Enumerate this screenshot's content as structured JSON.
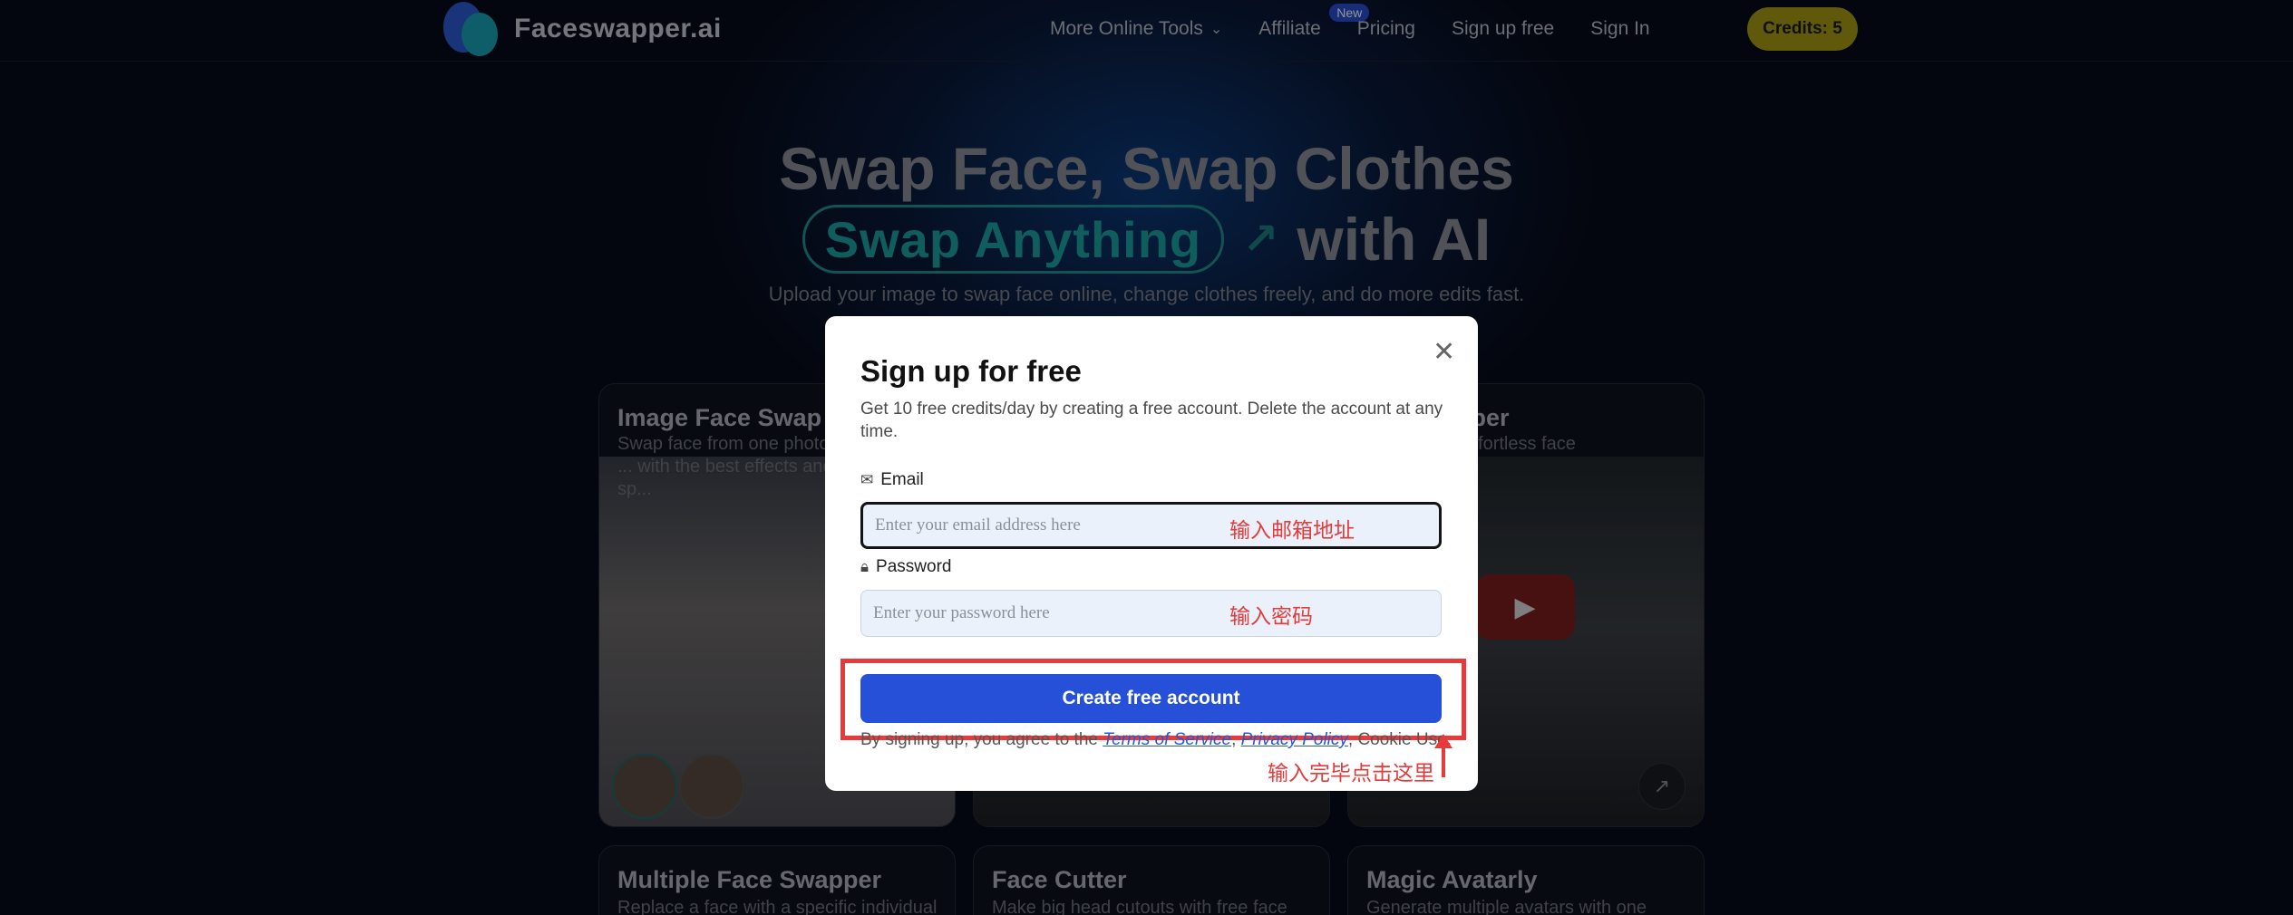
{
  "brand": {
    "name": "Faceswapper.ai"
  },
  "nav": {
    "items": [
      {
        "label": "More Online Tools"
      },
      {
        "label": "Affiliate",
        "badge": "New"
      },
      {
        "label": "Pricing"
      },
      {
        "label": "Sign up free"
      },
      {
        "label": "Sign In"
      }
    ],
    "credits_label": "Credits: 5"
  },
  "hero": {
    "line1": "Swap Face, Swap Clothes",
    "pill": "Swap Anything",
    "line2_rest": "with AI",
    "subtitle": "Upload your image to swap face online, change clothes freely, and do more edits fast."
  },
  "cards": [
    {
      "title": "Image Face Swap",
      "desc": "Swap face from one photo ... with the best effects and sp..."
    },
    {
      "title": "...e Swapper",
      "desc": "...deos with effortless face"
    },
    {
      "title": "Multiple Face Swapper",
      "desc": "Replace a face with a specific individual"
    },
    {
      "title": "Face Cutter",
      "desc": "Make big head cutouts with free face"
    },
    {
      "title": "Magic Avatarly",
      "desc": "Generate multiple avatars with one"
    }
  ],
  "modal": {
    "title": "Sign up for free",
    "description": "Get 10 free credits/day by creating a free account. Delete the account at any time.",
    "email_label": "Email",
    "email_placeholder": "Enter your email address here",
    "email_annotation": "输入邮箱地址",
    "password_label": "Password",
    "password_placeholder": "Enter your password here",
    "password_annotation": "输入密码",
    "cta_label": "Create free account",
    "legal_prefix": "By signing up, you agree to the ",
    "legal_terms": "Terms of Service",
    "legal_sep": ", ",
    "legal_privacy": "Privacy Policy",
    "legal_suffix": ", Cookie Use.",
    "cta_annotation": "输入完毕点击这里"
  },
  "colors": {
    "accent": "#2650d8",
    "credits": "#a69a14",
    "annotation": "#e53b3b",
    "pill": "#1ba0a0"
  }
}
